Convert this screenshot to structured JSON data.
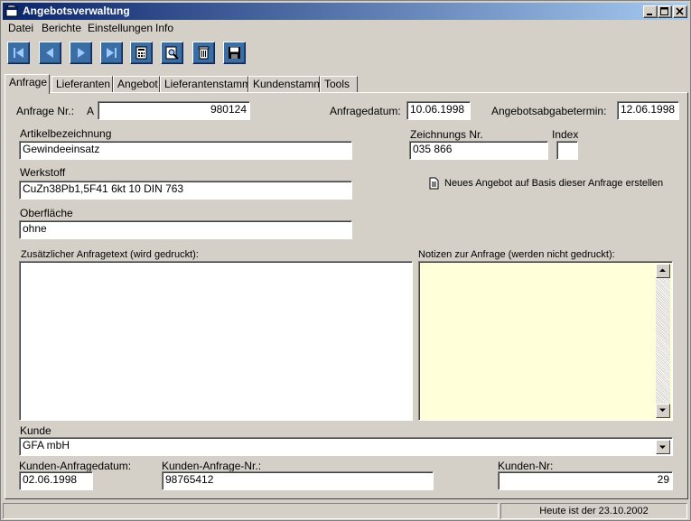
{
  "window": {
    "title": "Angebotsverwaltung"
  },
  "menu": [
    "Datei",
    "Berichte",
    "Einstellungen",
    "Info"
  ],
  "toolbar": {
    "first_icon": "first-record-icon",
    "prev_icon": "previous-record-icon",
    "next_icon": "next-record-icon",
    "last_icon": "last-record-icon",
    "calc_icon": "calculator-icon",
    "search_icon": "search-icon",
    "delete_icon": "trash-icon",
    "save_icon": "floppy-disk-icon"
  },
  "tabs": [
    "Anfrage",
    "Lieferanten",
    "Angebot",
    "Lieferantenstamm",
    "Kundenstamm",
    "Tools"
  ],
  "form": {
    "anfrage_nr_label": "Anfrage Nr.:",
    "anfrage_prefix": "A",
    "anfrage_nr": "980124",
    "anfragedatum_label": "Anfragedatum:",
    "anfragedatum": "10.06.1998",
    "abgabetermin_label": "Angebotsabgabetermin:",
    "abgabetermin": "12.06.1998",
    "artikel_label": "Artikelbezeichnung",
    "artikel": "Gewindeeinsatz",
    "zeichnung_label": "Zeichnungs Nr.",
    "zeichnung": "035 866",
    "index_label": "Index",
    "index": "",
    "werkstoff_label": "Werkstoff",
    "werkstoff": "CuZn38Pb1,5F41  6kt 10 DIN 763",
    "neues_angebot_label": "Neues Angebot auf Basis dieser Anfrage erstellen",
    "oberflaeche_label": "Oberfläche",
    "oberflaeche": "ohne",
    "zusatztext_label": "Zusätzlicher Anfragetext (wird gedruckt):",
    "notizen_label": "Notizen zur Anfrage (werden nicht gedruckt):",
    "kunde_label": "Kunde",
    "kunde": "GFA mbH",
    "kunden_anfragedatum_label": "Kunden-Anfragedatum:",
    "kunden_anfragedatum": "02.06.1998",
    "kunden_anfrage_nr_label": "Kunden-Anfrage-Nr.:",
    "kunden_anfrage_nr": "98765412",
    "kunden_nr_label": "Kunden-Nr:",
    "kunden_nr": "29"
  },
  "status": {
    "left": "",
    "right": "Heute ist der 23.10.2002"
  },
  "colors": {
    "title_start": "#0a246a",
    "title_end": "#a6caf0",
    "toolbar_button": "#3a6ea5",
    "notes_bg": "#ffffd9"
  }
}
